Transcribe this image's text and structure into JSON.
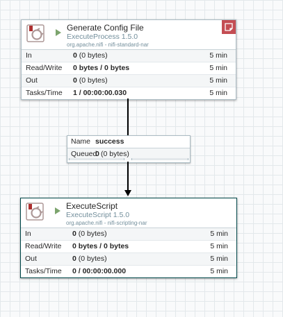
{
  "processors": [
    {
      "name": "Generate Config File",
      "type": "ExecuteProcess 1.5.0",
      "bundle": "org.apache.nifi - nifi-standard-nar",
      "stats": [
        {
          "label": "In",
          "value_bold": "0",
          "value_rest": "(0 bytes)",
          "time": "5 min"
        },
        {
          "label": "Read/Write",
          "value_bold": "0 bytes / 0 bytes",
          "value_rest": "",
          "time": "5 min"
        },
        {
          "label": "Out",
          "value_bold": "0",
          "value_rest": "(0 bytes)",
          "time": "5 min"
        },
        {
          "label": "Tasks/Time",
          "value_bold": "1 / 00:00:00.030",
          "value_rest": "",
          "time": "5 min"
        }
      ]
    },
    {
      "name": "ExecuteScript",
      "type": "ExecuteScript 1.5.0",
      "bundle": "org.apache.nifi - nifi-scripting-nar",
      "stats": [
        {
          "label": "In",
          "value_bold": "0",
          "value_rest": "(0 bytes)",
          "time": "5 min"
        },
        {
          "label": "Read/Write",
          "value_bold": "0 bytes / 0 bytes",
          "value_rest": "",
          "time": "5 min"
        },
        {
          "label": "Out",
          "value_bold": "0",
          "value_rest": "(0 bytes)",
          "time": "5 min"
        },
        {
          "label": "Tasks/Time",
          "value_bold": "0 / 00:00:00.000",
          "value_rest": "",
          "time": "5 min"
        }
      ]
    }
  ],
  "connection": {
    "name_label": "Name",
    "name_value": "success",
    "queued_label": "Queued",
    "queued_bold": "0",
    "queued_rest": "(0 bytes)"
  },
  "icons": {
    "processor": "processor-icon",
    "run_state": "play-icon",
    "bulletin": "bulletin-icon"
  },
  "colors": {
    "run_state": "#7ca46d",
    "bulletin": "#c44d53",
    "secondary_text": "#728e9b",
    "selected_border": "#004849"
  }
}
